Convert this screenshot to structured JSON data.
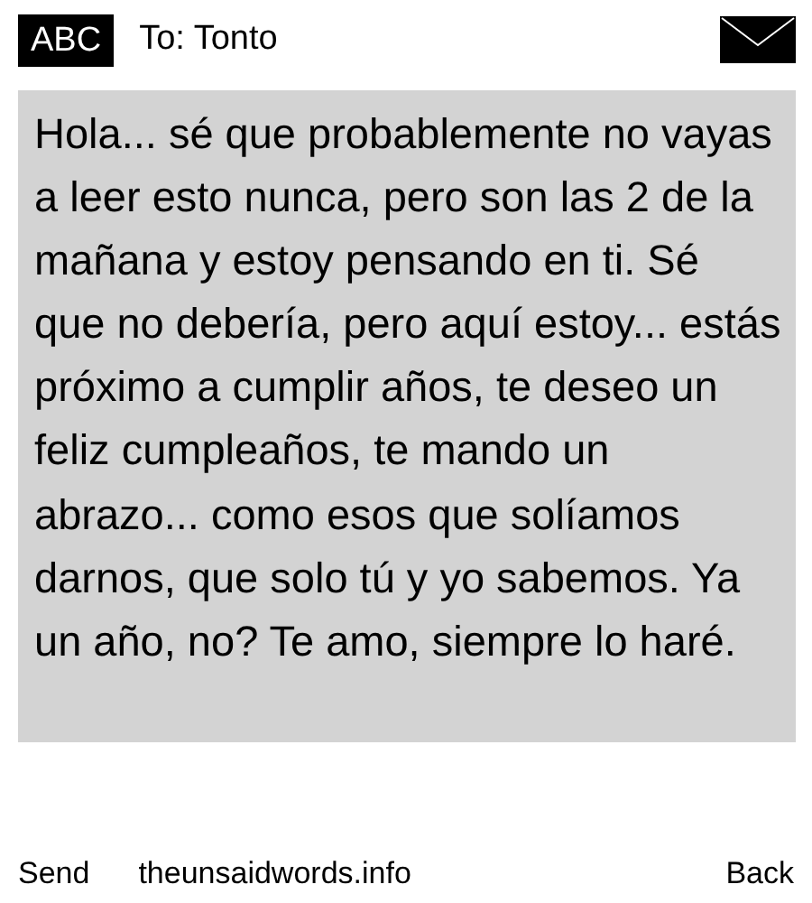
{
  "header": {
    "mode": "ABC",
    "recipient": "To: Tonto"
  },
  "message": "Hola... sé que probablemente no vayas a leer esto nunca, pero son las 2 de la mañana y estoy pensando en ti. Sé que no debería, pero aquí estoy... estás próximo a cumplir años, te deseo un feliz cumpleaños, te mando un abrazo... como esos que solíamos darnos, que solo tú y yo sabemos. Ya un año, no? Te amo, siempre lo haré.",
  "softkeys": {
    "left": "Send",
    "center": "theunsaidwords.info",
    "right": "Back"
  }
}
